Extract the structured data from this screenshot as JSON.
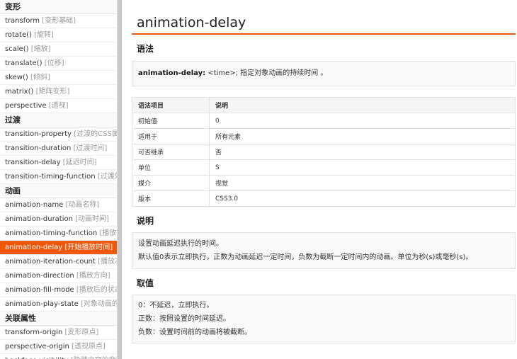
{
  "sidebar": {
    "sections": [
      {
        "title": "变形",
        "items": [
          {
            "name": "transform",
            "zh": "[变形基础]"
          },
          {
            "name": "rotate()",
            "zh": "[旋转]"
          },
          {
            "name": "scale()",
            "zh": "[缩放]"
          },
          {
            "name": "translate()",
            "zh": "[位移]"
          },
          {
            "name": "skew()",
            "zh": "[倾斜]"
          },
          {
            "name": "matrix()",
            "zh": "[矩阵变形]"
          },
          {
            "name": "perspective",
            "zh": "[透视]"
          }
        ]
      },
      {
        "title": "过渡",
        "items": [
          {
            "name": "transition-property",
            "zh": "[过渡的CSS属性]"
          },
          {
            "name": "transition-duration",
            "zh": "[过渡时间]"
          },
          {
            "name": "transition-delay",
            "zh": "[延迟时间]"
          },
          {
            "name": "transition-timing-function",
            "zh": "[过渡效果]"
          }
        ]
      },
      {
        "title": "动画",
        "items": [
          {
            "name": "animation-name",
            "zh": "[动画名称]"
          },
          {
            "name": "animation-duration",
            "zh": "[动画时间]"
          },
          {
            "name": "animation-timing-function",
            "zh": "[播放方式]"
          },
          {
            "name": "animation-delay",
            "zh": "[开始播放时间]",
            "active": true
          },
          {
            "name": "animation-iteration-count",
            "zh": "[播放次数]"
          },
          {
            "name": "animation-direction",
            "zh": "[播放方向]"
          },
          {
            "name": "animation-fill-mode",
            "zh": "[播放后的状态]"
          },
          {
            "name": "animation-play-state",
            "zh": "[对象动画的状"
          }
        ]
      },
      {
        "title": "关联属性",
        "items": [
          {
            "name": "transform-origin",
            "zh": "[变形原点]"
          },
          {
            "name": "perspective-origin",
            "zh": "[透视原点]"
          },
          {
            "name": "backface-visibility",
            "zh": "[隐藏内容的背面]"
          }
        ]
      }
    ]
  },
  "main": {
    "title": "animation-delay",
    "syntax_heading": "语法",
    "syntax": {
      "property": "animation-delay:",
      "value": "<time>",
      "rest": "; 指定对象动画的持续时间 。"
    },
    "table": {
      "headers": [
        "语法项目",
        "说明"
      ],
      "rows": [
        [
          "初始值",
          "0"
        ],
        [
          "适用于",
          "所有元素"
        ],
        [
          "可否继承",
          "否"
        ],
        [
          "单位",
          "S"
        ],
        [
          "媒介",
          "视觉"
        ],
        [
          "版本",
          "CSS3.0"
        ]
      ]
    },
    "desc_heading": "说明",
    "desc_lines": [
      "设置动画延迟执行的时间。",
      "默认值0表示立即执行，正数为动画延迟一定时间，负数为截断一定时间内的动画。单位为秒(s)或毫秒(s)。"
    ],
    "values_heading": "取值",
    "values_lines": [
      "0：不延迟，立即执行。",
      "正数：按照设置的时间延迟。",
      "负数：设置时间前的动画将被截断。"
    ]
  }
}
